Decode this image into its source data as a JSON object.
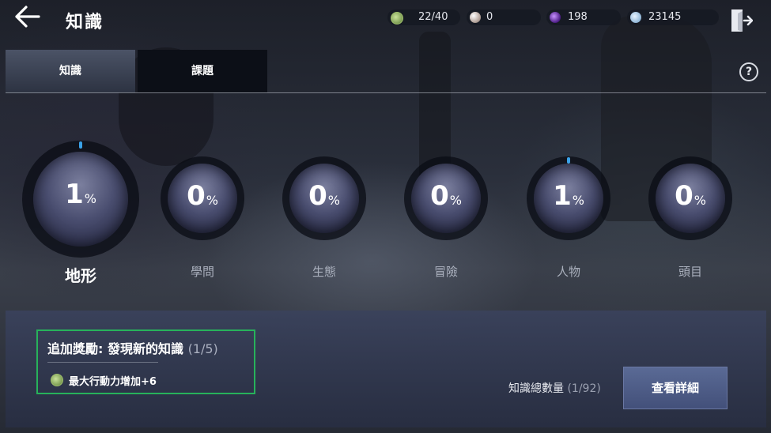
{
  "header": {
    "back_icon": "arrow-left-icon",
    "title": "知識",
    "resources": [
      {
        "icon": "action-point-icon",
        "value": "22/40"
      },
      {
        "icon": "pearl-icon",
        "value": "0"
      },
      {
        "icon": "purple-gem-icon",
        "value": "198"
      },
      {
        "icon": "silver-coin-icon",
        "value": "23145"
      }
    ],
    "exit_icon": "exit-door-icon"
  },
  "tabs": [
    {
      "label": "知識",
      "active": true
    },
    {
      "label": "課題",
      "active": false
    }
  ],
  "help_label": "?",
  "categories": [
    {
      "name": "地形",
      "percent": "1",
      "sign": "%",
      "progress": 0.01,
      "selected": true
    },
    {
      "name": "學問",
      "percent": "0",
      "sign": "%",
      "progress": 0,
      "selected": false
    },
    {
      "name": "生態",
      "percent": "0",
      "sign": "%",
      "progress": 0,
      "selected": false
    },
    {
      "name": "冒險",
      "percent": "0",
      "sign": "%",
      "progress": 0,
      "selected": false
    },
    {
      "name": "人物",
      "percent": "1",
      "sign": "%",
      "progress": 0.01,
      "selected": false
    },
    {
      "name": "頭目",
      "percent": "0",
      "sign": "%",
      "progress": 0,
      "selected": false
    }
  ],
  "bonus": {
    "title": "追加獎勵: 發現新的知識",
    "count": "(1/5)",
    "reward_icon": "action-point-icon",
    "reward": "最大行動力增加+6"
  },
  "summary": {
    "label": "知識總數量",
    "count": "(1/92)"
  },
  "details_button": "查看詳細",
  "colors": {
    "progress": "#3aa2e8",
    "highlight_border": "#27b25b",
    "panel": "#3a425c"
  }
}
